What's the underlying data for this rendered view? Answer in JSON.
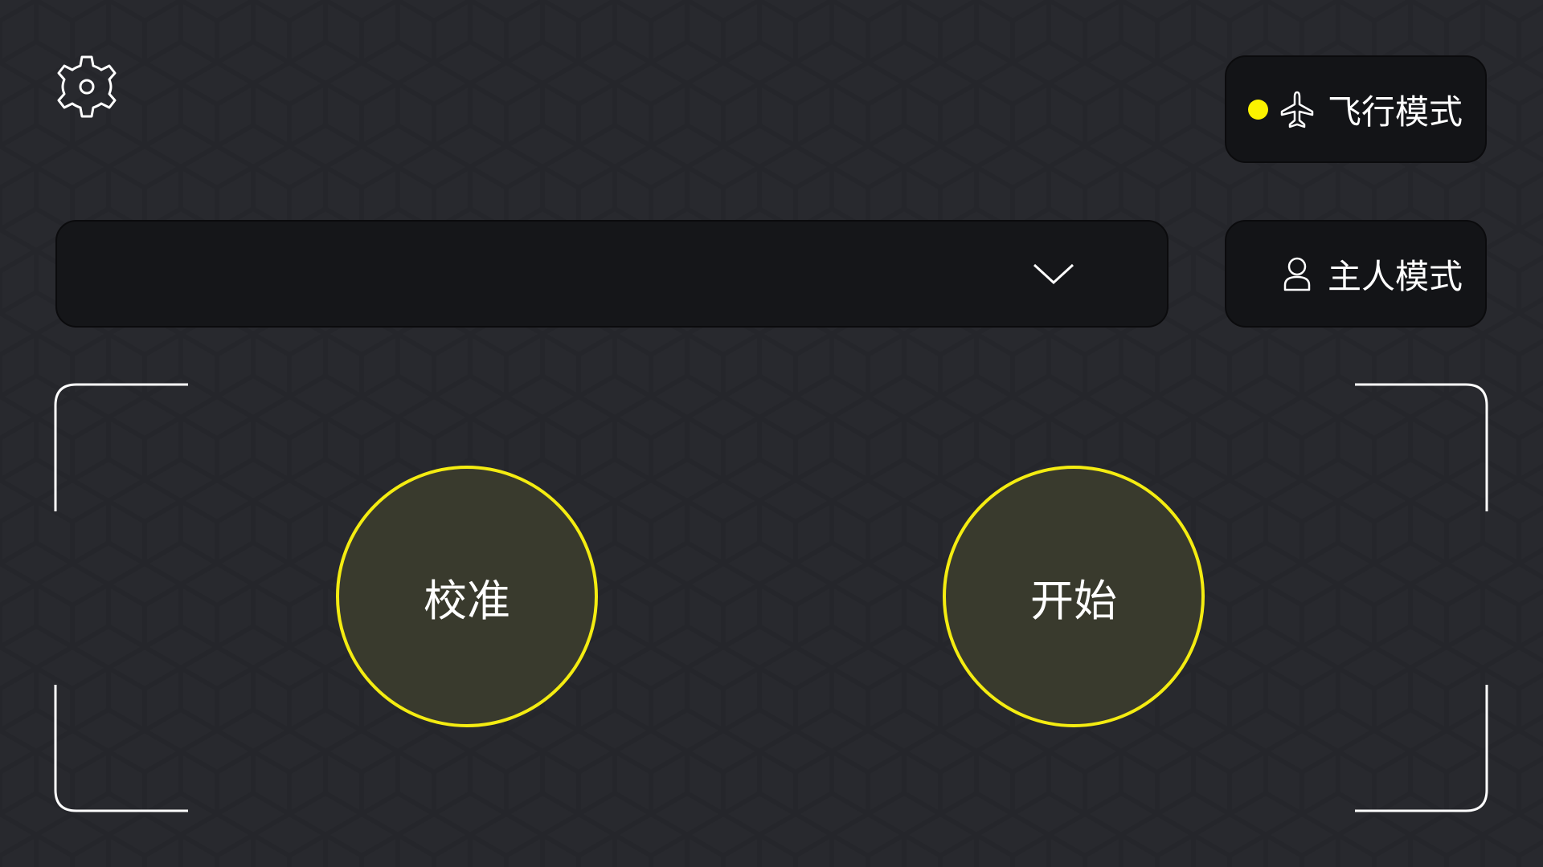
{
  "settings": {
    "icon": "gear-icon"
  },
  "mode_buttons": {
    "flight": {
      "label": "飞行模式",
      "icon": "airplane-icon",
      "status_color": "#fbf200"
    },
    "owner": {
      "label": "主人模式",
      "icon": "person-icon"
    }
  },
  "device_select": {
    "value": "",
    "icon": "chevron-down-icon"
  },
  "controls": {
    "calibrate_label": "校准",
    "start_label": "开始"
  },
  "colors": {
    "background": "#28292e",
    "panel": "#131417",
    "accent": "#f4ec11",
    "button_fill": "#393a2d",
    "text": "#ffffff"
  }
}
